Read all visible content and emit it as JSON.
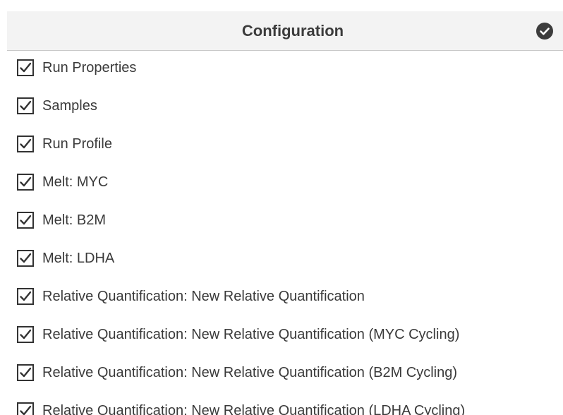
{
  "header": {
    "title": "Configuration",
    "status_icon": "check-circle-icon",
    "status_color": "#3c3c3c"
  },
  "items": [
    {
      "label": "Run Properties",
      "checked": true
    },
    {
      "label": "Samples",
      "checked": true
    },
    {
      "label": "Run Profile",
      "checked": true
    },
    {
      "label": "Melt: MYC",
      "checked": true
    },
    {
      "label": "Melt: B2M",
      "checked": true
    },
    {
      "label": "Melt: LDHA",
      "checked": true
    },
    {
      "label": "Relative Quantification: New Relative Quantification",
      "checked": true
    },
    {
      "label": "Relative Quantification: New Relative Quantification (MYC Cycling)",
      "checked": true
    },
    {
      "label": "Relative Quantification: New Relative Quantification (B2M Cycling)",
      "checked": true
    },
    {
      "label": "Relative Quantification: New Relative Quantification (LDHA Cycling)",
      "checked": true
    }
  ]
}
